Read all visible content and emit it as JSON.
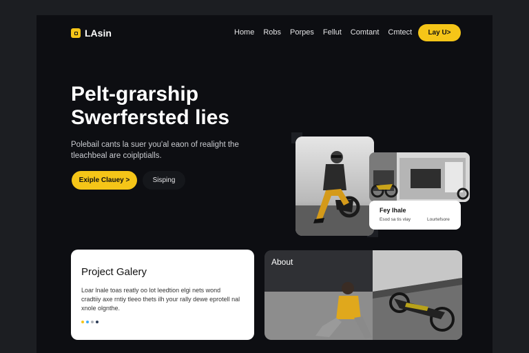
{
  "brand": {
    "name": "LAsin",
    "accent": "#f5c518"
  },
  "nav": {
    "items": [
      "Home",
      "Robs",
      "Porpes",
      "Fellut",
      "Comtant",
      "Cmtect"
    ]
  },
  "header_cta": "Lay U>",
  "hero": {
    "title_line1": "Pelt-grarship",
    "title_line2": "Swerfersted lies",
    "subtitle": "Polebail cants la suer you'al eaon of realight the tleachbeal are coiplptialls.",
    "primary_button": "Exiple Clauey >",
    "secondary_button": "Sisping"
  },
  "info_card": {
    "title": "Fey Ihale",
    "left_text": "Esod sa tis vlay",
    "right_text": "Lourtefsore"
  },
  "gallery_card": {
    "title": "Project Galery",
    "text": "Loar lnale toas reatly oo lot leedtion elgi nets wond cradtiiy axe rntiy tleeo thets ilh your rally dewe eprotell nal xnole olgnthe.",
    "dot_colors": [
      "#f5c518",
      "#3fa9f5",
      "#b0b4bb",
      "#2b3a55"
    ]
  },
  "about_card": {
    "label": "About"
  }
}
